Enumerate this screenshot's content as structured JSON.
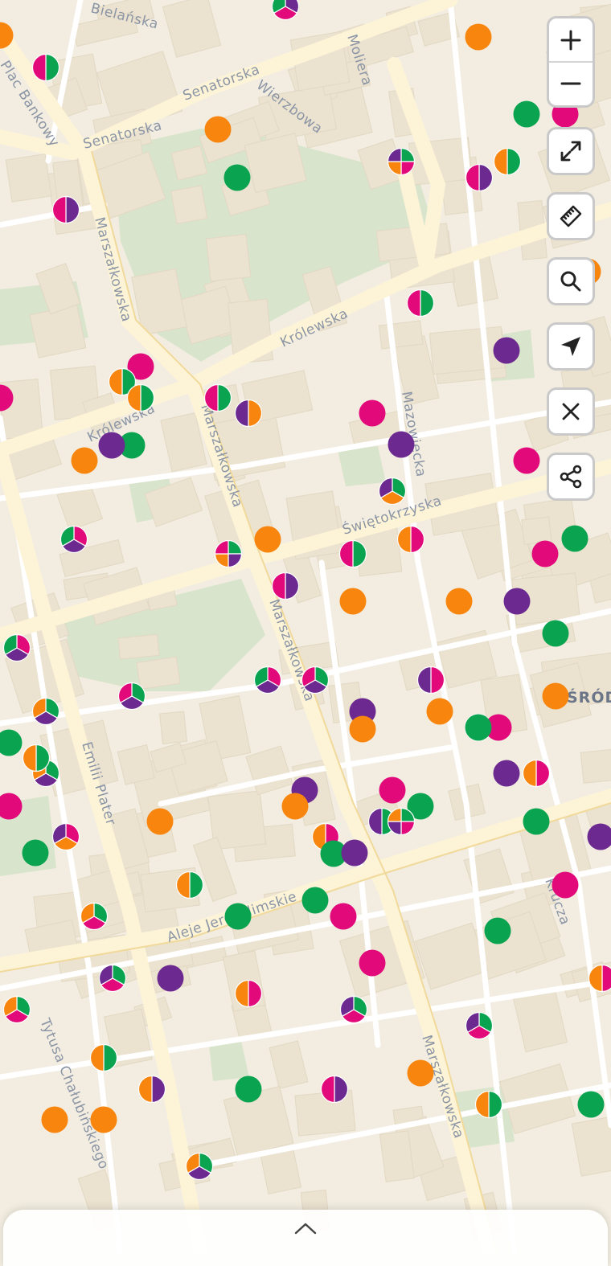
{
  "map": {
    "street_labels": [
      {
        "id": "bielanska",
        "text": "Bielańska"
      },
      {
        "id": "plac-bankowy",
        "text": "Plac Bankowy"
      },
      {
        "id": "senatorska-1",
        "text": "Senatorska"
      },
      {
        "id": "senatorska-2",
        "text": "Senatorska"
      },
      {
        "id": "wierzbowa",
        "text": "Wierzbowa"
      },
      {
        "id": "moliera",
        "text": "Moliera"
      },
      {
        "id": "marszalkowska-1",
        "text": "Marszałkowska"
      },
      {
        "id": "krolewska-1",
        "text": "Królewska"
      },
      {
        "id": "krolewska-2",
        "text": "Królewska"
      },
      {
        "id": "marszalkowska-2",
        "text": "Marszałkowska"
      },
      {
        "id": "mazowiecka",
        "text": "Mazowiecka"
      },
      {
        "id": "swietokrzyska",
        "text": "Świętokrzyska"
      },
      {
        "id": "marszalkowska-3",
        "text": "Marszałkowska"
      },
      {
        "id": "emilii-plater",
        "text": "Emilii Plater"
      },
      {
        "id": "aleje-jerozolimskie",
        "text": "Aleje Jerozolimskie"
      },
      {
        "id": "krucza",
        "text": "Krucza"
      },
      {
        "id": "tytusa",
        "text": "Tytusa Chałubińskiego"
      },
      {
        "id": "marszalkowska-4",
        "text": "Marszałkowska"
      }
    ],
    "district_label": "ŚRÓDMIEŚCIE",
    "colors": {
      "green": "#0aa350",
      "magenta": "#e2097a",
      "orange": "#f8860e",
      "purple": "#6c2a91"
    }
  },
  "markers": [
    [
      "purple",
      "magenta",
      "green"
    ],
    [
      "orange"
    ],
    [
      "green",
      "magenta"
    ],
    [
      "orange"
    ],
    [
      "orange"
    ],
    [
      "green"
    ],
    [
      "magenta"
    ],
    [
      "green",
      "magenta",
      "orange",
      "purple"
    ],
    [
      "purple",
      "magenta"
    ],
    [
      "green",
      "orange"
    ],
    [
      "green"
    ],
    [
      "purple",
      "magenta"
    ],
    [
      "orange"
    ],
    [
      "green",
      "magenta"
    ],
    [
      "purple"
    ],
    [
      "magenta"
    ],
    [
      "green",
      "orange"
    ],
    [
      "green",
      "orange"
    ],
    [
      "green",
      "magenta"
    ],
    [
      "orange",
      "purple"
    ],
    [
      "magenta"
    ],
    [
      "magenta"
    ],
    [
      "purple"
    ],
    [
      "green"
    ],
    [
      "orange"
    ],
    [
      "green",
      "orange",
      "purple"
    ],
    [
      "magenta"
    ],
    [
      "purple"
    ],
    [
      "magenta",
      "purple",
      "green"
    ],
    [
      "green",
      "purple",
      "orange",
      "magenta"
    ],
    [
      "orange"
    ],
    [
      "magenta",
      "orange"
    ],
    [
      "green",
      "magenta"
    ],
    [
      "green"
    ],
    [
      "magenta"
    ],
    [
      "purple",
      "magenta"
    ],
    [
      "orange"
    ],
    [
      "orange"
    ],
    [
      "purple"
    ],
    [
      "magenta",
      "purple",
      "green"
    ],
    [
      "green"
    ],
    [
      "green",
      "purple",
      "magenta"
    ],
    [
      "magenta",
      "purple",
      "green"
    ],
    [
      "magenta",
      "purple"
    ],
    [
      "green",
      "purple",
      "orange"
    ],
    [
      "purple"
    ],
    [
      "orange"
    ],
    [
      "orange"
    ],
    [
      "green",
      "magenta"
    ],
    [
      "magenta"
    ],
    [
      "orange"
    ],
    [
      "green",
      "purple",
      "magenta"
    ],
    [
      "green",
      "purple",
      "orange"
    ],
    [
      "green"
    ],
    [
      "green",
      "orange"
    ],
    [
      "purple"
    ],
    [
      "green",
      "magenta",
      "purple"
    ],
    [
      "purple"
    ],
    [
      "magenta"
    ],
    [
      "orange"
    ],
    [
      "green"
    ],
    [
      "green",
      "purple"
    ],
    [
      "magenta"
    ],
    [
      "magenta",
      "orange"
    ],
    [
      "green"
    ],
    [
      "green",
      "magenta",
      "purple",
      "orange"
    ],
    [
      "green"
    ],
    [
      "magenta",
      "orange",
      "purple"
    ],
    [
      "green"
    ],
    [
      "purple"
    ],
    [
      "green",
      "orange"
    ],
    [
      "magenta"
    ],
    [
      "green"
    ],
    [
      "purple",
      "green",
      "orange"
    ],
    [
      "green"
    ],
    [
      "magenta"
    ],
    [
      "green"
    ],
    [
      "magenta"
    ],
    [
      "magenta",
      "orange"
    ],
    [
      "orange"
    ],
    [
      "green",
      "magenta",
      "purple"
    ],
    [
      "purple"
    ],
    [
      "green",
      "magenta",
      "purple"
    ],
    [
      "magenta",
      "orange"
    ],
    [
      "green",
      "magenta",
      "orange"
    ],
    [
      "green",
      "magenta",
      "purple"
    ],
    [
      "green",
      "orange"
    ],
    [
      "purple",
      "orange"
    ],
    [
      "green"
    ],
    [
      "purple",
      "magenta"
    ],
    [
      "orange"
    ],
    [
      "green",
      "orange"
    ],
    [
      "orange"
    ],
    [
      "orange"
    ],
    [
      "green",
      "purple",
      "orange"
    ],
    [
      "green",
      "magenta",
      "orange"
    ],
    [
      "green"
    ],
    [
      "purple"
    ],
    [
      "magenta",
      "orange"
    ],
    [
      "green"
    ]
  ],
  "controls": {
    "zoom_in": "zoom-in",
    "zoom_out": "zoom-out",
    "fullscreen": "fullscreen",
    "measure": "measure",
    "search": "search",
    "locate": "locate",
    "clear": "clear",
    "share": "share"
  },
  "bottom_sheet": {
    "handle": "expand"
  }
}
